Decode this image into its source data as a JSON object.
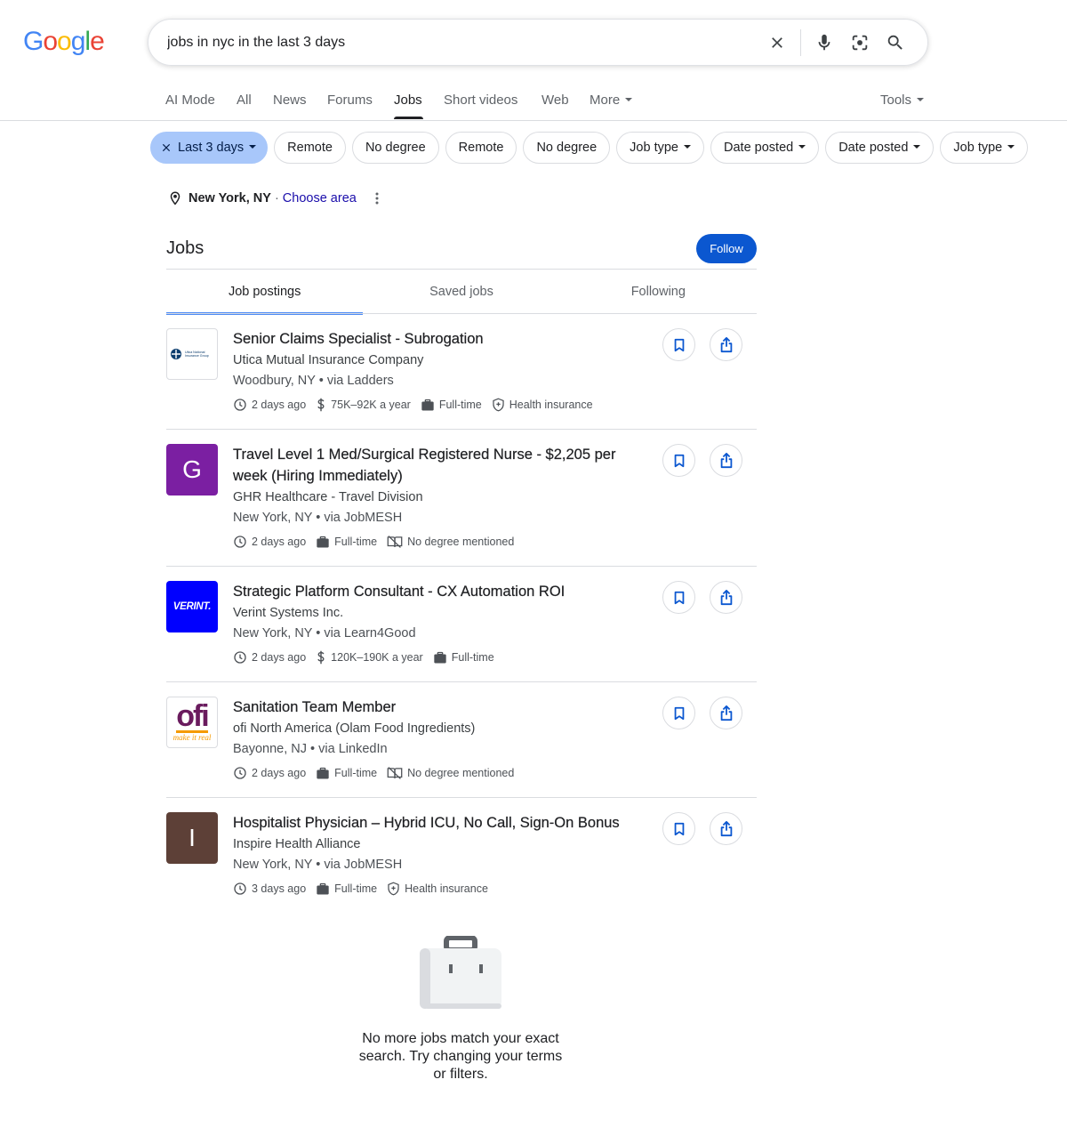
{
  "logo": {
    "letters": [
      "G",
      "o",
      "o",
      "g",
      "l",
      "e"
    ],
    "colors": [
      "#4285F4",
      "#EA4335",
      "#FBBC05",
      "#4285F4",
      "#34A853",
      "#EA4335"
    ]
  },
  "search": {
    "query": "jobs in nyc in the last 3 days",
    "icons": [
      "close-icon",
      "mic-icon",
      "lens-icon",
      "search-icon"
    ]
  },
  "nav": {
    "tabs": [
      "AI Mode",
      "All",
      "News",
      "Forums",
      "Jobs",
      "Short videos",
      "Web",
      "More"
    ],
    "active": "Jobs",
    "tools": "Tools"
  },
  "chips": [
    {
      "label": "Last 3 days",
      "active": true,
      "dropdown": true
    },
    {
      "label": "Remote",
      "active": false,
      "dropdown": false
    },
    {
      "label": "No degree",
      "active": false,
      "dropdown": false
    },
    {
      "label": "Remote",
      "active": false,
      "dropdown": false
    },
    {
      "label": "No degree",
      "active": false,
      "dropdown": false
    },
    {
      "label": "Job type",
      "active": false,
      "dropdown": true
    },
    {
      "label": "Date posted",
      "active": false,
      "dropdown": true
    },
    {
      "label": "Date posted",
      "active": false,
      "dropdown": true
    },
    {
      "label": "Job type",
      "active": false,
      "dropdown": true
    }
  ],
  "location": {
    "city": "New York, NY",
    "separator": "·",
    "choose": "Choose area"
  },
  "jobs_section": {
    "title": "Jobs",
    "follow": "Follow",
    "tabs": [
      "Job postings",
      "Saved jobs",
      "Following"
    ],
    "active_tab": "Job postings"
  },
  "jobs": [
    {
      "title": "Senior Claims Specialist - Subrogation",
      "company": "Utica Mutual Insurance Company",
      "location": "Woodbury, NY • via Ladders",
      "logo": {
        "type": "utica",
        "text": "Utica National Insurance Group"
      },
      "meta": [
        {
          "icon": "clock-icon",
          "text": "2 days ago"
        },
        {
          "icon": "dollar-icon",
          "text": "75K–92K a year"
        },
        {
          "icon": "briefcase-icon",
          "text": "Full-time"
        },
        {
          "icon": "health-shield-icon",
          "text": "Health insurance"
        }
      ]
    },
    {
      "title": "Travel Level 1 Med/Surgical Registered Nurse - $2,205 per week (Hiring Immediately)",
      "company": "GHR Healthcare - Travel Division",
      "location": "New York, NY • via JobMESH",
      "logo": {
        "type": "letter",
        "text": "G",
        "bg": "#7b1fa2"
      },
      "meta": [
        {
          "icon": "clock-icon",
          "text": "2 days ago"
        },
        {
          "icon": "briefcase-icon",
          "text": "Full-time"
        },
        {
          "icon": "degree-book-icon",
          "text": "No degree mentioned"
        }
      ]
    },
    {
      "title": "Strategic Platform Consultant - CX Automation ROI",
      "company": "Verint Systems Inc.",
      "location": "New York, NY • via Learn4Good",
      "logo": {
        "type": "verint",
        "text": "VERINT.",
        "bg": "#0000ff"
      },
      "meta": [
        {
          "icon": "clock-icon",
          "text": "2 days ago"
        },
        {
          "icon": "dollar-icon",
          "text": "120K–190K a year"
        },
        {
          "icon": "briefcase-icon",
          "text": "Full-time"
        }
      ]
    },
    {
      "title": "Sanitation Team Member",
      "company": "ofi North America (Olam Food Ingredients)",
      "location": "Bayonne, NJ • via LinkedIn",
      "logo": {
        "type": "ofi",
        "text": "ofi",
        "tagline": "make it real"
      },
      "meta": [
        {
          "icon": "clock-icon",
          "text": "2 days ago"
        },
        {
          "icon": "briefcase-icon",
          "text": "Full-time"
        },
        {
          "icon": "degree-book-icon",
          "text": "No degree mentioned"
        }
      ]
    },
    {
      "title": "Hospitalist Physician – Hybrid ICU, No Call, Sign-On Bonus",
      "company": "Inspire Health Alliance",
      "location": "New York, NY • via JobMESH",
      "logo": {
        "type": "letter",
        "text": "I",
        "bg": "#5d4037"
      },
      "meta": [
        {
          "icon": "clock-icon",
          "text": "3 days ago"
        },
        {
          "icon": "briefcase-icon",
          "text": "Full-time"
        },
        {
          "icon": "health-shield-icon",
          "text": "Health insurance"
        }
      ]
    }
  ],
  "empty_state": {
    "icon": "briefcase-icon",
    "text": "No more jobs match your exact search. Try changing your terms or filters."
  }
}
